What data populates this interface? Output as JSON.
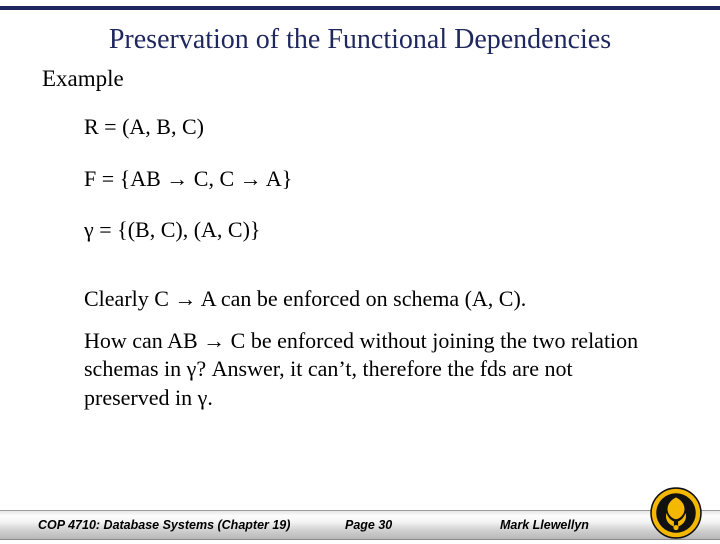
{
  "title": "Preservation of the Functional Dependencies",
  "example_label": "Example",
  "lines": {
    "r": "R = (A, B, C)",
    "f": "F = {AB → C, C → A}",
    "gamma": "γ = {(B, C), (A, C)}"
  },
  "paragraphs": {
    "p1": "Clearly C → A can be enforced on schema (A, C).",
    "p2": "How can AB → C be enforced without joining the two relation schemas in γ?  Answer, it can’t, therefore the fds are not preserved in γ."
  },
  "footer": {
    "left": "COP 4710: Database Systems  (Chapter 19)",
    "center": "Page 30",
    "right": "Mark Llewellyn"
  },
  "logo_name": "ucf-pegasus-logo"
}
